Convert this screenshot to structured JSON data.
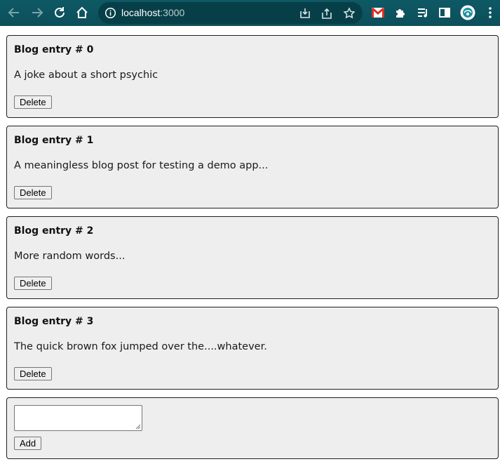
{
  "browser": {
    "url_host": "localhost",
    "url_port": ":3000"
  },
  "posts": [
    {
      "title": "Blog entry # 0",
      "body": "A joke about a short psychic",
      "delete_label": "Delete"
    },
    {
      "title": "Blog entry # 1",
      "body": "A meaningless blog post for testing a demo app...",
      "delete_label": "Delete"
    },
    {
      "title": "Blog entry # 2",
      "body": "More random words...",
      "delete_label": "Delete"
    },
    {
      "title": "Blog entry # 3",
      "body": "The quick brown fox jumped over the....whatever.",
      "delete_label": "Delete"
    }
  ],
  "new_post": {
    "textarea_value": "",
    "add_label": "Add"
  },
  "colors": {
    "toolbar": "#0b4f5a",
    "card_bg": "#eeeeee",
    "card_border": "#1f1f1f"
  }
}
